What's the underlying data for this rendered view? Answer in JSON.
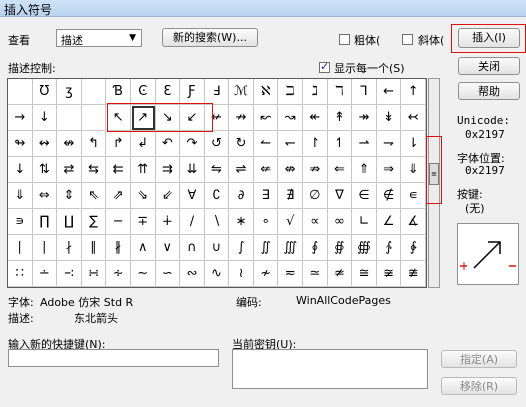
{
  "window": {
    "title": "插入符号"
  },
  "toolbar": {
    "view_label": "查看",
    "view_selected": "描述",
    "new_search_label": "新的搜索(W)...",
    "bold_label": "粗体(",
    "italic_label": "斜体(",
    "insert_label": "插入(I)",
    "close_label": "关闭",
    "help_label": "帮助"
  },
  "controls": {
    "describe_label": "描述控制:",
    "show_each_label": "显示每一个(S)",
    "show_each_checked": true,
    "bold_checked": false,
    "italic_checked": false
  },
  "info": {
    "unicode_label": "Unicode:",
    "unicode_value": "0x2197",
    "font_pos_label": "字体位置:",
    "font_pos_value": "0x2197",
    "key_label": "按键:",
    "key_value": "(无)"
  },
  "symbols": {
    "selected_index": 6,
    "rows": [
      [
        "",
        "Ʊ",
        "ʒ",
        "",
        "Ɓ",
        "Ͼ",
        "Ɛ",
        "Ƒ",
        "Ⅎ",
        "ℳ",
        "ℵ",
        "ℶ",
        "ℷ",
        "ℸ",
        "⅂",
        "←",
        "↑"
      ],
      [
        "→",
        "↓",
        "",
        "",
        "↖",
        "↗",
        "↘",
        "↙",
        "↚",
        "↛",
        "↜",
        "↝",
        "↞",
        "↟",
        "↠",
        "↡",
        "↢"
      ],
      [
        "↬",
        "↭",
        "↮",
        "↰",
        "↱",
        "↲",
        "↶",
        "↷",
        "↺",
        "↻",
        "↼",
        "↽",
        "↾",
        "↿",
        "⇀",
        "⇁",
        "⇂"
      ],
      [
        "↓",
        "⇅",
        "⇄",
        "⇆",
        "⇇",
        "⇈",
        "⇉",
        "⇊",
        "⇋",
        "⇌",
        "⇍",
        "⇎",
        "⇏",
        "⇐",
        "⇑",
        "⇒",
        "⇓"
      ],
      [
        "⇓",
        "⇔",
        "⇕",
        "⇖",
        "⇗",
        "⇘",
        "⇙",
        "∀",
        "∁",
        "∂",
        "∃",
        "∄",
        "∅",
        "∇",
        "∈",
        "∉",
        "∊"
      ],
      [
        "∍",
        "∏",
        "∐",
        "∑",
        "−",
        "∓",
        "∔",
        "∕",
        "∖",
        "∗",
        "∘",
        "√",
        "∝",
        "∞",
        "∟",
        "∠",
        "∡"
      ],
      [
        "∣",
        "∣",
        "∤",
        "∥",
        "∦",
        "∧",
        "∨",
        "∩",
        "∪",
        "∫",
        "∬",
        "∭",
        "∮",
        "∯",
        "∰",
        "∱",
        "∲"
      ],
      [
        "∷",
        "∸",
        "∹",
        "∺",
        "∻",
        "∼",
        "∽",
        "∾",
        "∿",
        "≀",
        "≁",
        "≂",
        "≃",
        "≄",
        "≅",
        "≆",
        "≇"
      ]
    ]
  },
  "status": {
    "font_label": "字体:",
    "font_value": "Adobe 仿宋 Std R",
    "encoding_label": "编码:",
    "encoding_value": "WinAllCodePages",
    "desc_label": "描述:",
    "desc_value": "东北箭头"
  },
  "shortcut": {
    "new_shortcut_label": "输入新的快捷键(N):",
    "new_shortcut_value": "",
    "current_key_label": "当前密钥(U):",
    "assign_label": "指定(A)",
    "remove_label": "移除(R)"
  },
  "colors": {
    "highlight": "#d11111",
    "title_bg": "#b9d3ee"
  }
}
